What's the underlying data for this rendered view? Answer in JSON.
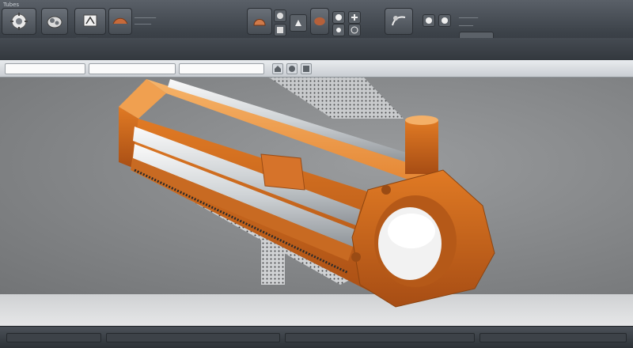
{
  "app": {
    "title": "Tubes"
  },
  "colors": {
    "accent": "#e07a24",
    "accent_dark": "#b4571a",
    "accent_light": "#f3a555",
    "ribbon_bg": "#3c4249",
    "viewport_bg": "#8a8c8e"
  },
  "ribbon": {
    "buttons": [
      {
        "name": "part-tool-button",
        "icon": "gear-part-icon"
      },
      {
        "name": "assembly-tool-button",
        "icon": "assembly-icon"
      },
      {
        "name": "sketch-tool-button",
        "icon": "sketch-icon"
      },
      {
        "name": "shape-tool-button",
        "icon": "shape-icon"
      },
      {
        "name": "surface-tool-button",
        "icon": "surface-icon"
      },
      {
        "name": "simulation-tool-button",
        "icon": "simulation-icon"
      }
    ]
  },
  "model": {
    "name": "orange-tubular-part"
  }
}
